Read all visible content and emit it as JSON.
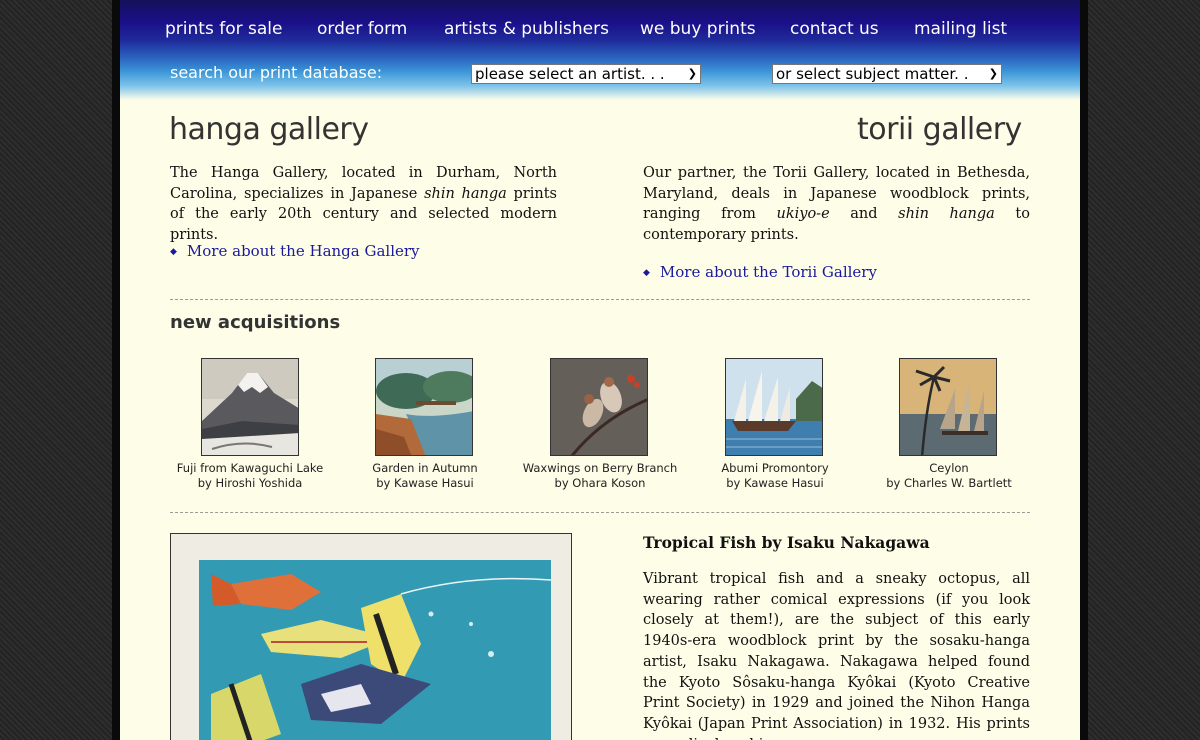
{
  "nav": {
    "items": [
      {
        "label": "prints for sale"
      },
      {
        "label": "order form"
      },
      {
        "label": "artists & publishers"
      },
      {
        "label": "we buy prints"
      },
      {
        "label": "contact us"
      },
      {
        "label": "mailing list"
      }
    ]
  },
  "search": {
    "label": "search our print database:",
    "artist_select": "please select an artist. . .",
    "subject_select": "or select subject matter. ."
  },
  "hanga": {
    "title": "hanga gallery",
    "p_before": "The Hanga Gallery, located in Durham, North Carolina, specializes in Japanese ",
    "p_em": "shin hanga",
    "p_after": " prints of the early 20th century and selected modern prints.",
    "more": "More about the Hanga Gallery"
  },
  "torii": {
    "title": "torii gallery",
    "p1": "Our partner, the Torii Gallery, located in Bethesda, Maryland, deals in Japanese woodblock prints, ranging from ",
    "em1": "ukiyo-e",
    "p2": " and ",
    "em2": "shin hanga",
    "p3": " to contemporary prints.",
    "more": "More about the Torii Gallery"
  },
  "acquisitions": {
    "title": "new acquisitions",
    "items": [
      {
        "title": "Fuji from Kawaguchi Lake",
        "artist": "by Hiroshi Yoshida"
      },
      {
        "title": "Garden in Autumn",
        "artist": "by Kawase Hasui"
      },
      {
        "title": "Waxwings on Berry Branch",
        "artist": "by Ohara Koson"
      },
      {
        "title": "Abumi Promontory",
        "artist": "by Kawase Hasui"
      },
      {
        "title": "Ceylon",
        "artist": "by Charles W. Bartlett"
      }
    ]
  },
  "feature": {
    "title": "Tropical Fish by Isaku Nakagawa",
    "body": "Vibrant tropical fish and a sneaky octopus, all wearing rather comical expressions (if you look closely at them!), are the subject of this early 1940s-era woodblock print by the sosaku-hanga artist, Isaku Nakagawa. Nakagawa helped found the Kyoto Sôsaku-hanga Kyôkai (Kyoto Creative Print Society) in 1929 and joined the Nihon Hanga Kyôkai (Japan Print Association) in 1932. His prints were displayed in"
  }
}
